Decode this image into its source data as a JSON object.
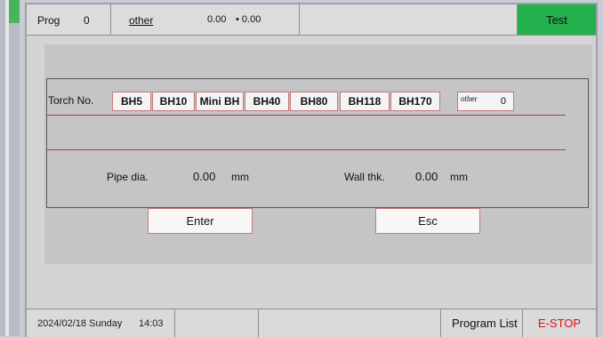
{
  "header": {
    "prog_label": "Prog",
    "prog_value": "0",
    "program_name": "other",
    "value_a": "0.00",
    "value_b": "• 0.00",
    "mode_label": "Test"
  },
  "torch": {
    "label": "Torch No.",
    "options": [
      "BH5",
      "BH10",
      "Mini BH",
      "BH40",
      "BH80",
      "BH118",
      "BH170"
    ],
    "other_label": "other",
    "other_value": "0"
  },
  "params": {
    "pipe_dia_label": "Pipe dia.",
    "pipe_dia_value": "0.00",
    "pipe_dia_unit": "mm",
    "wall_thk_label": "Wall thk.",
    "wall_thk_value": "0.00",
    "wall_thk_unit": "mm"
  },
  "actions": {
    "enter_label": "Enter",
    "esc_label": "Esc"
  },
  "footer": {
    "date": "2024/02/18 Sunday",
    "time": "14:03",
    "program_list_label": "Program List",
    "estop_label": "E-STOP"
  },
  "colors": {
    "test_green": "#22b14c",
    "estop_red": "#dd1111",
    "button_border": "#c77d7d"
  }
}
